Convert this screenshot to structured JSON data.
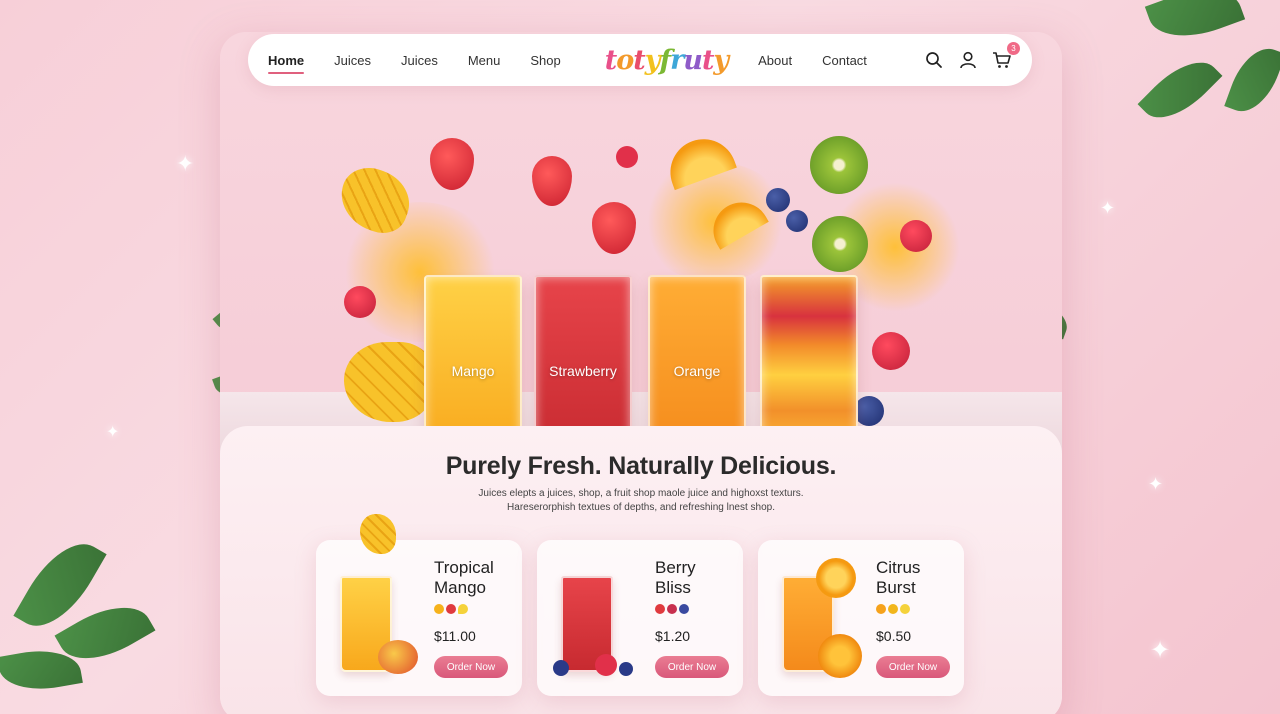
{
  "nav": {
    "links": [
      "Home",
      "Juices",
      "Juices",
      "Menu",
      "Shop"
    ],
    "links_right": [
      "About",
      "Contact"
    ],
    "logo": "totyfruty",
    "cart_count": "3",
    "icons": [
      "search-icon",
      "user-icon",
      "cart-icon"
    ]
  },
  "hero": {
    "glasses": [
      "Mango",
      "Strawberry",
      "Orange"
    ]
  },
  "content": {
    "headline": "Purely Fresh. Naturally Delicious.",
    "sub_line1": "Juices elepts a juices, shop, a fruit shop maole juice and highoxst texturs.",
    "sub_line2": "Hareserorphish textues of depths, and refreshing lnest shop."
  },
  "products": [
    {
      "name_line1": "Tropical",
      "name_line2": "Mango",
      "price": "$11.00",
      "button": "Order Now"
    },
    {
      "name_line1": "Berry",
      "name_line2": "Bliss",
      "price": "$1.20",
      "button": "Order Now"
    },
    {
      "name_line1": "Citrus",
      "name_line2": "Burst",
      "price": "$0.50",
      "button": "Order Now"
    }
  ],
  "colors": {
    "accent": "#e0607e",
    "button": "#d9587a",
    "background": "#f7cfd8"
  }
}
